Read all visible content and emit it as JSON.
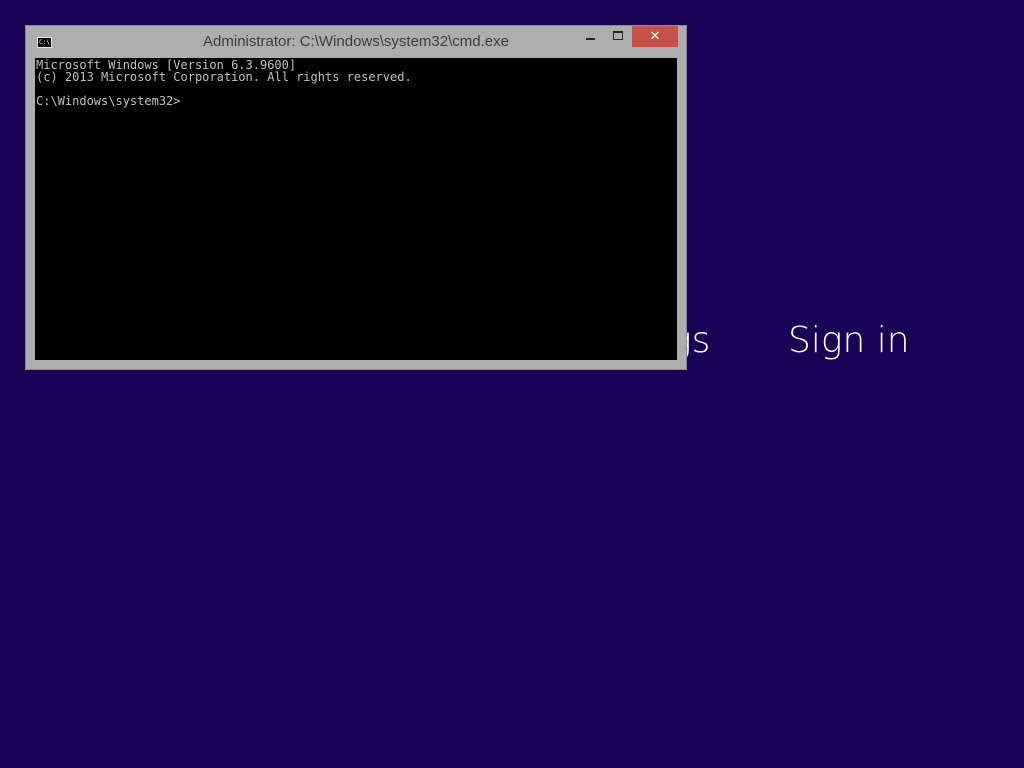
{
  "background": {
    "color": "#1a0054",
    "headings": {
      "settings_fragment": "gs",
      "sign_in": "Sign in"
    }
  },
  "window": {
    "title": "Administrator: C:\\Windows\\system32\\cmd.exe",
    "icon_label": "C:\\.",
    "icon": "cmd-console-icon",
    "buttons": {
      "minimize_icon": "minimize-icon",
      "maximize_icon": "maximize-icon",
      "close_glyph": "✕",
      "close_color": "#c7504a"
    },
    "frame_color": "#adadad"
  },
  "console": {
    "lines": [
      "Microsoft Windows [Version 6.3.9600]",
      "(c) 2013 Microsoft Corporation. All rights reserved.",
      "",
      "C:\\Windows\\system32>"
    ],
    "background": "#000000",
    "text_color": "#c0c0c0"
  }
}
